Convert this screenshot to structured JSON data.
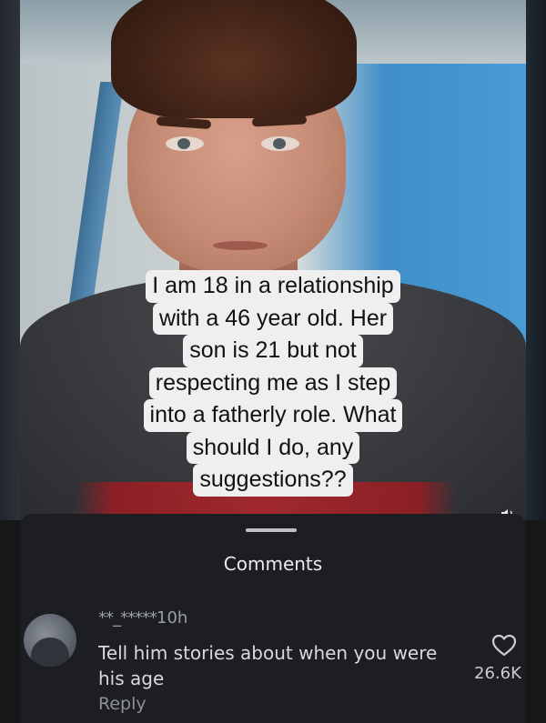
{
  "post": {
    "caption_lines": [
      "I am 18 in a relationship",
      "with a 46 year old. Her",
      "son is 21 but not",
      "respecting me as I step",
      "into a fatherly role. What",
      "should I do, any",
      "suggestions??"
    ]
  },
  "comments_sheet": {
    "title": "Comments",
    "comment": {
      "username": "**_*****",
      "time": "10h",
      "text": "Tell him stories about when you were his age",
      "reply_label": "Reply",
      "likes": "26.6K"
    }
  },
  "icons": {
    "like": "heart-outline-icon",
    "sound": "speaker-icon"
  },
  "colors": {
    "sheet_bg": "#1c1e21",
    "caption_bg": "#efefef",
    "page_bg": "#161719"
  }
}
